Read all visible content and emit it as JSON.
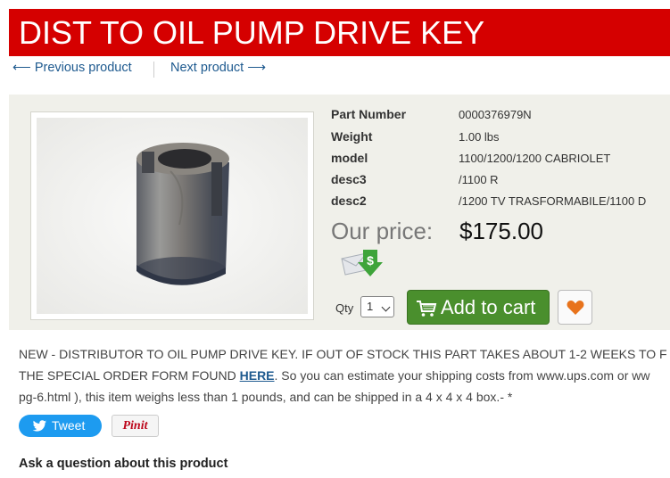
{
  "page_title": "DIST TO OIL PUMP DRIVE KEY",
  "nav": {
    "previous": "⟵ Previous product",
    "next": "Next product ⟶"
  },
  "specs": [
    {
      "label": "Part Number",
      "value": "0000376979N"
    },
    {
      "label": "Weight",
      "value": "1.00 lbs"
    },
    {
      "label": "model",
      "value": "1100/1200/1200 CABRIOLET"
    },
    {
      "label": "desc3",
      "value": "/1100 R"
    },
    {
      "label": "desc2",
      "value": "/1200 TV TRASFORMABILE/1100 D"
    }
  ],
  "price": {
    "label": "Our price:",
    "value": "$175.00"
  },
  "quantity": {
    "label": "Qty",
    "selected": "1"
  },
  "buttons": {
    "add_to_cart": "Add to cart",
    "tweet": "Tweet",
    "pinit": "Pinit"
  },
  "description": {
    "line1": "NEW - DISTRIBUTOR TO OIL PUMP DRIVE KEY. IF OUT OF STOCK THIS PART TAKES ABOUT 1-2 WEEKS TO F",
    "line2_pre": "THE SPECIAL ORDER FORM FOUND ",
    "link": "HERE",
    "line2_post": ". So you can estimate your shipping costs from www.ups.com or ww",
    "line3": "pg-6.html ), this item weighs less than 1 pounds, and can be shipped in a 4 x 4 x 4 box.- *"
  },
  "ask_question": "Ask a question about this product",
  "colors": {
    "title_bar": "#d50000",
    "cart_button": "#4a8f2d",
    "link": "#1e5a8f",
    "tweet": "#1d9bf0"
  }
}
